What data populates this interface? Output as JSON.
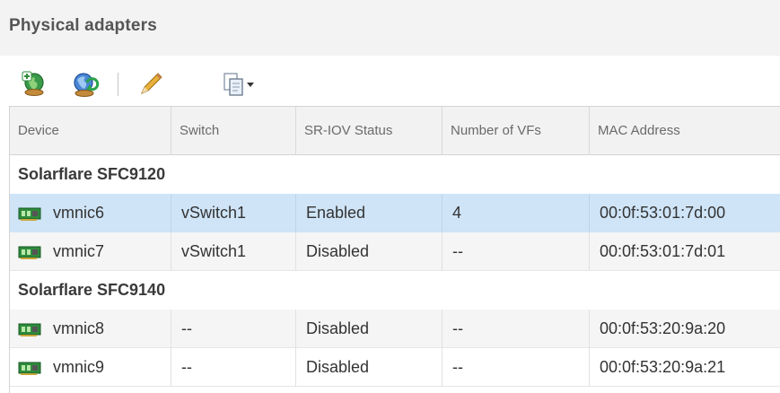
{
  "panel": {
    "title": "Physical adapters"
  },
  "toolbar": {
    "buttons": [
      {
        "name": "add-networking-icon"
      },
      {
        "name": "refresh-icon"
      },
      {
        "name": "edit-icon"
      },
      {
        "name": "copy-dropdown-icon"
      }
    ]
  },
  "table": {
    "columns": [
      "Device",
      "Switch",
      "SR-IOV Status",
      "Number of VFs",
      "MAC Address"
    ],
    "groups": [
      {
        "name": "Solarflare SFC9120",
        "rows": [
          {
            "device": "vmnic6",
            "switch": "vSwitch1",
            "sriov": "Enabled",
            "vfs": "4",
            "mac": "00:0f:53:01:7d:00",
            "selected": true
          },
          {
            "device": "vmnic7",
            "switch": "vSwitch1",
            "sriov": "Disabled",
            "vfs": "--",
            "mac": "00:0f:53:01:7d:01",
            "selected": false
          }
        ]
      },
      {
        "name": "Solarflare SFC9140",
        "rows": [
          {
            "device": "vmnic8",
            "switch": "--",
            "sriov": "Disabled",
            "vfs": "--",
            "mac": "00:0f:53:20:9a:20",
            "selected": false
          },
          {
            "device": "vmnic9",
            "switch": "--",
            "sriov": "Disabled",
            "vfs": "--",
            "mac": "00:0f:53:20:9a:21",
            "selected": false
          }
        ]
      }
    ]
  },
  "colors": {
    "selected_row": "#cfe4f7",
    "nic_green": "#2e8b3c",
    "refresh_blue": "#2f6fc4"
  }
}
